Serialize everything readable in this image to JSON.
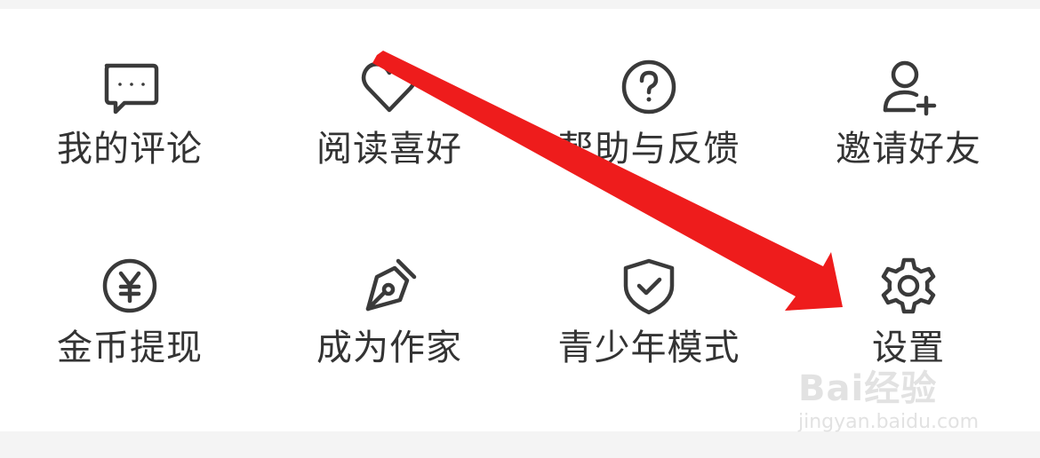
{
  "menu": {
    "items": [
      {
        "label": "我的评论",
        "icon": "comment-icon"
      },
      {
        "label": "阅读喜好",
        "icon": "heart-icon"
      },
      {
        "label": "帮助与反馈",
        "icon": "help-icon"
      },
      {
        "label": "邀请好友",
        "icon": "add-user-icon"
      },
      {
        "label": "金币提现",
        "icon": "yuan-coin-icon"
      },
      {
        "label": "成为作家",
        "icon": "pen-nib-icon"
      },
      {
        "label": "青少年模式",
        "icon": "shield-check-icon"
      },
      {
        "label": "设置",
        "icon": "gear-icon"
      }
    ]
  },
  "annotation": {
    "color": "#ee1c1c",
    "points_to": "设置"
  },
  "watermark": {
    "brand": "Bai经验",
    "url": "jingyan.baidu.com"
  },
  "colors": {
    "text": "#333333",
    "icon": "#3a3a3a",
    "background": "#f4f4f4",
    "panel": "#ffffff"
  }
}
